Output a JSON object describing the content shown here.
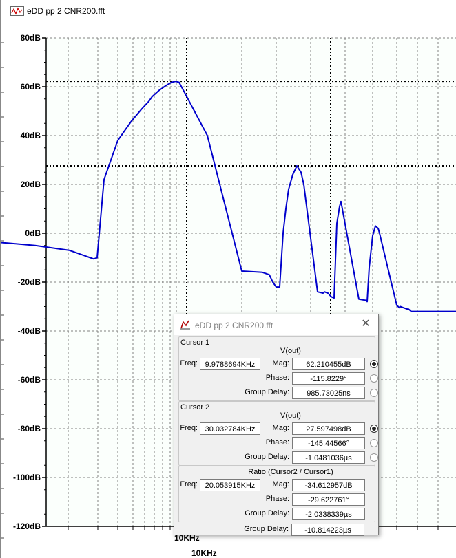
{
  "window": {
    "title": "eDD pp 2 CNR200.fft"
  },
  "chart_data": {
    "type": "line",
    "title": "",
    "xlabel": "10KHz",
    "ylabel": "",
    "x_tick_labels": [
      "10KHz",
      "10KHz"
    ],
    "y_ticks": [
      80,
      60,
      40,
      20,
      0,
      -20,
      -40,
      -60,
      -80,
      -100,
      -120
    ],
    "y_tick_labels": [
      "80dB",
      "60dB",
      "40dB",
      "20dB",
      "0dB",
      "-20dB",
      "-40dB",
      "-60dB",
      "-80dB",
      "-100dB",
      "-120dB"
    ],
    "ylim": [
      -120,
      80
    ],
    "grid": true,
    "series": [
      {
        "name": "V(out)",
        "color": "#0000cc",
        "x": [
          0,
          10,
          50,
          100,
          120,
          130,
          135,
          140,
          150,
          170,
          190,
          205,
          215,
          220,
          230,
          240,
          248,
          254,
          259,
          259,
          270,
          300,
          350,
          380,
          390,
          395,
          400,
          405,
          410,
          414,
          418,
          424,
          430,
          436,
          440,
          440,
          460,
          468,
          470,
          475,
          480,
          484,
          488,
          492,
          494,
          494,
          520,
          531,
          532,
          535,
          540,
          544,
          548,
          550,
          550,
          575,
          579,
          580,
          585,
          590,
          592,
          594,
          596,
          596,
          662
        ],
        "y": [
          -3.8,
          -4,
          -5,
          -7,
          -9,
          -10,
          -10.5,
          -10,
          22,
          38,
          46,
          51,
          54,
          56,
          58.5,
          60.5,
          61.8,
          62.2,
          61.8,
          61.8,
          56,
          40,
          -15.5,
          -16,
          -17,
          -20,
          -22,
          -22,
          0,
          10,
          18,
          24,
          27.6,
          25,
          20,
          20,
          -24,
          -24.5,
          -24,
          -24.5,
          -26,
          -26.5,
          4,
          11,
          13,
          13,
          -27,
          -27.5,
          -28,
          -14,
          -1,
          3,
          2,
          0,
          0,
          -29.5,
          -30.5,
          -30,
          -30.5,
          -31,
          -31,
          -31.5,
          -32,
          -32,
          -32
        ]
      }
    ],
    "cursors": [
      {
        "name": "Cursor 1",
        "freq_khz": 9.9788694,
        "mag_db": 62.210455
      },
      {
        "name": "Cursor 2",
        "freq_khz": 30.032784,
        "mag_db": 27.597498
      }
    ]
  },
  "dialog": {
    "title": "eDD pp 2 CNR200.fft",
    "close_glyph": "✕",
    "cursor1": {
      "label": "Cursor 1",
      "signal": "V(out)",
      "freq_label": "Freq:",
      "freq": "9.9788694KHz",
      "mag_label": "Mag:",
      "mag": "62.210455dB",
      "phase_label": "Phase:",
      "phase": "-115.8229°",
      "gd_label": "Group Delay:",
      "gd": "985.73025ns"
    },
    "cursor2": {
      "label": "Cursor 2",
      "signal": "V(out)",
      "freq_label": "Freq:",
      "freq": "30.032784KHz",
      "mag_label": "Mag:",
      "mag": "27.597498dB",
      "phase_label": "Phase:",
      "phase": "-145.44566°",
      "gd_label": "Group Delay:",
      "gd": "-1.0481036µs"
    },
    "ratio": {
      "label": "Ratio (Cursor2 / Cursor1)",
      "freq_label": "Freq:",
      "freq": "20.053915KHz",
      "mag_label": "Mag:",
      "mag": "-34.612957dB",
      "phase_label": "Phase:",
      "phase": "-29.622761°",
      "gd_label": "Group Delay:",
      "gd": "-2.0338339µs",
      "gd2": "-10.814223µs"
    }
  }
}
